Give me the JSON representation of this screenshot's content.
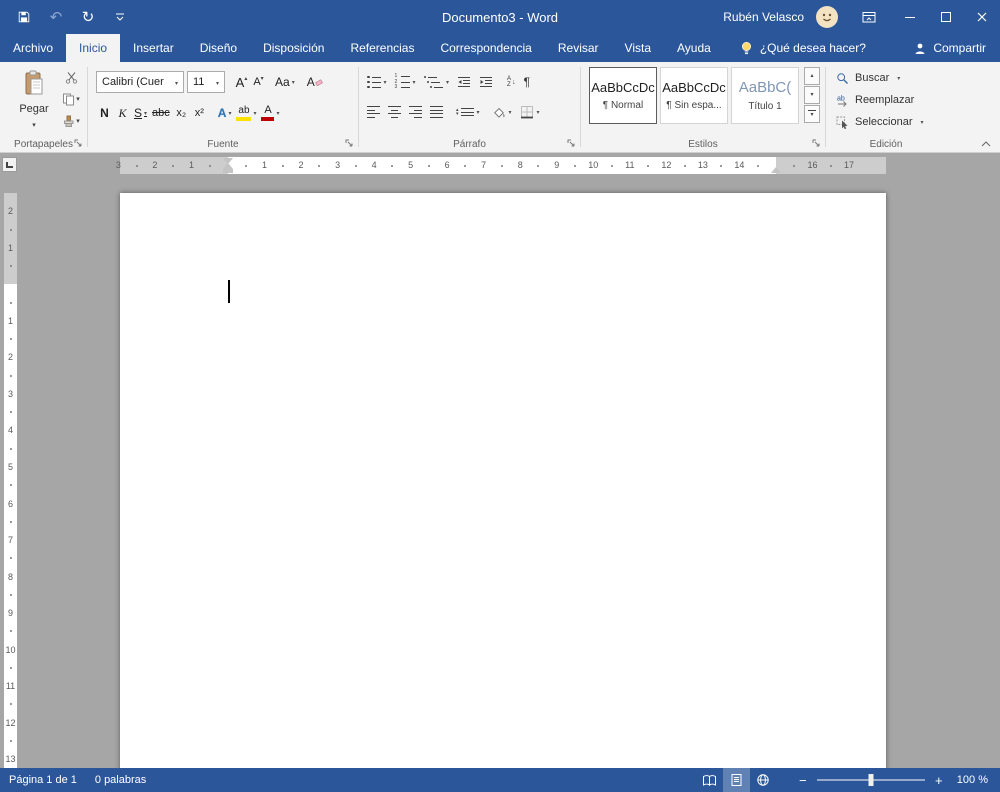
{
  "titlebar": {
    "title": "Documento3 - Word",
    "user_name": "Rubén Velasco",
    "icons": {
      "undo": "↶",
      "redo": "↻"
    }
  },
  "tabs": {
    "file": "Archivo",
    "items": [
      "Inicio",
      "Insertar",
      "Diseño",
      "Disposición",
      "Referencias",
      "Correspondencia",
      "Revisar",
      "Vista",
      "Ayuda"
    ],
    "tell_me": "¿Qué desea hacer?",
    "share": "Compartir"
  },
  "ribbon": {
    "clipboard": {
      "group_label": "Portapapeles",
      "paste_label": "Pegar"
    },
    "font": {
      "group_label": "Fuente",
      "font_name": "Calibri (Cuer",
      "font_size": "11",
      "grow": "A",
      "shrink": "A",
      "change_case": "Aa",
      "clear_format": "A",
      "bold": "N",
      "italic": "K",
      "underline": "S",
      "strikethrough": "abc",
      "subscript": "x₂",
      "superscript": "x²",
      "effects": "A",
      "highlight": "ab",
      "font_color": "A"
    },
    "paragraph": {
      "group_label": "Párrafo",
      "pilcrow": "¶",
      "sort_a": "A",
      "sort_z": "Z"
    },
    "styles": {
      "group_label": "Estilos",
      "items": [
        {
          "preview": "AaBbCcDc",
          "name": "¶ Normal"
        },
        {
          "preview": "AaBbCcDc",
          "name": "¶ Sin espa..."
        },
        {
          "preview": "AaBbC(",
          "name": "Título 1"
        }
      ]
    },
    "editing": {
      "group_label": "Edición",
      "find": "Buscar",
      "replace": "Reemplazar",
      "select": "Seleccionar"
    }
  },
  "ruler": {
    "h_numbers": [
      "3",
      "2",
      "1",
      "",
      "1",
      "2",
      "3",
      "4",
      "5",
      "6",
      "7",
      "8",
      "9",
      "10",
      "11",
      "12",
      "13",
      "14",
      "",
      "16",
      "17"
    ],
    "v_numbers": [
      "2",
      "1",
      "",
      "1",
      "2",
      "3",
      "4",
      "5",
      "6",
      "7",
      "8",
      "9",
      "10",
      "11",
      "12",
      "13"
    ]
  },
  "statusbar": {
    "page_info": "Página 1 de 1",
    "word_count": "0 palabras",
    "zoom_out": "−",
    "zoom_in": "+",
    "zoom_level": "100 %"
  },
  "colors": {
    "accent": "#2b579a",
    "highlight_yellow": "#ffe100",
    "font_color_red": "#c00000"
  }
}
